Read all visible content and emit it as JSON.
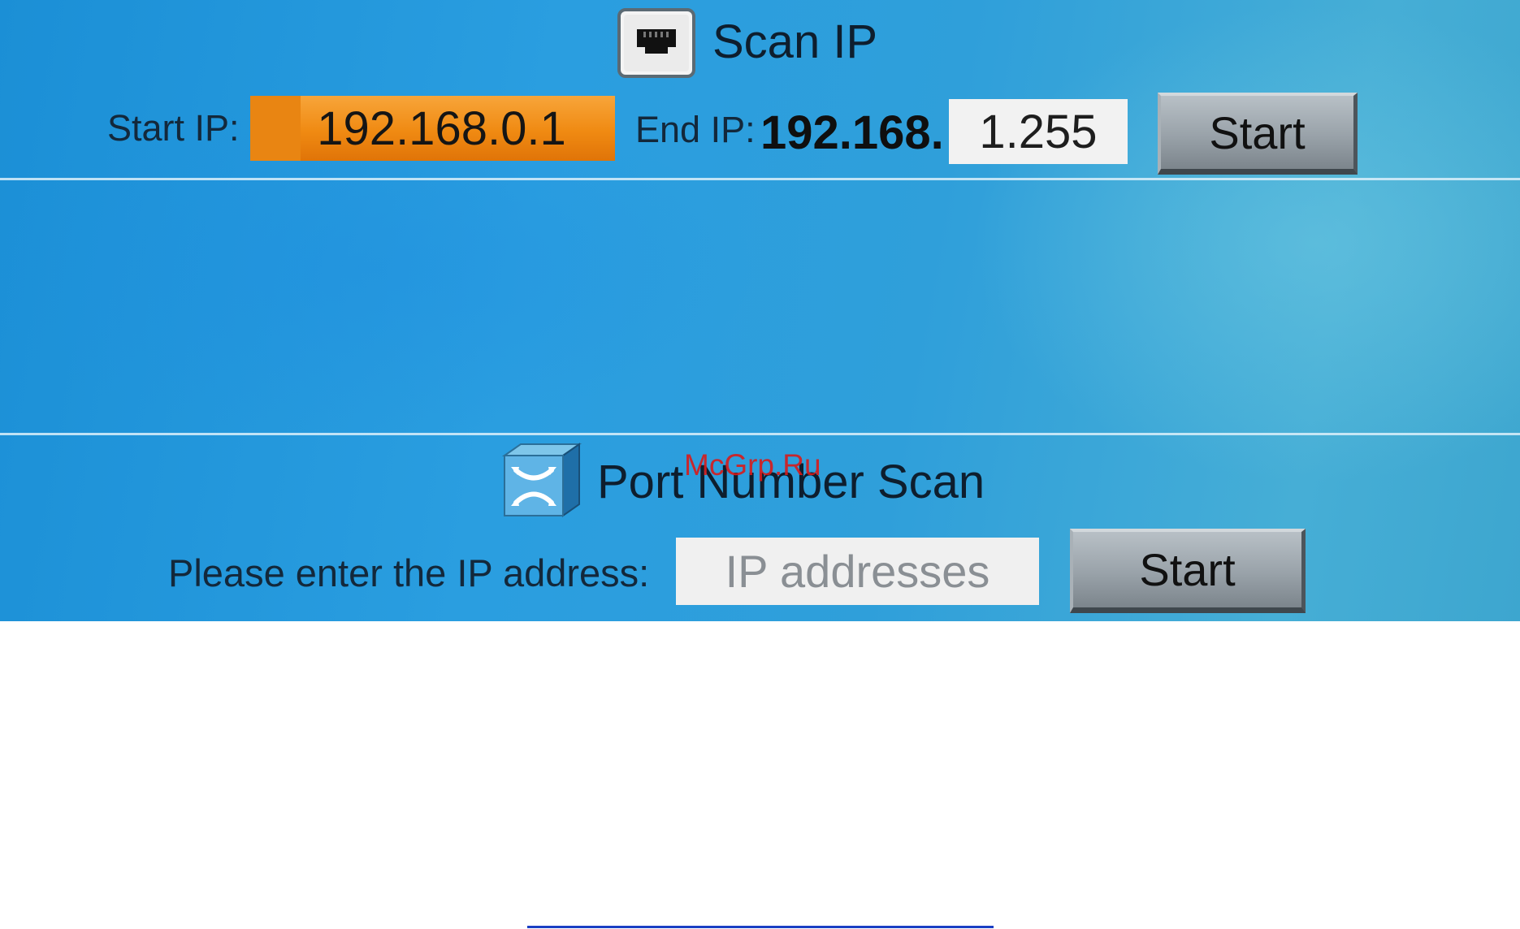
{
  "scan_ip": {
    "title": "Scan IP",
    "icon": "ethernet-port-icon",
    "start_ip_label": "Start IP:",
    "start_ip_value": "192.168.0.1",
    "end_ip_label": "End IP:",
    "end_ip_prefix": "192.168.",
    "end_ip_value": "1.255",
    "start_button_label": "Start"
  },
  "port_scan": {
    "title": "Port Number Scan",
    "icon": "network-switch-icon",
    "ip_prompt_label": "Please enter the IP address:",
    "ip_input_placeholder": "IP addresses",
    "start_button_label": "Start"
  },
  "watermark": "McGrp.Ru",
  "colors": {
    "screen_background": "#2a9ee0",
    "start_ip_field": "#f08a12",
    "end_ip_field": "#f2f2f2",
    "button": "#99a2a9",
    "watermark": "#d81b1b",
    "bottom_line": "#1a3fc4"
  }
}
